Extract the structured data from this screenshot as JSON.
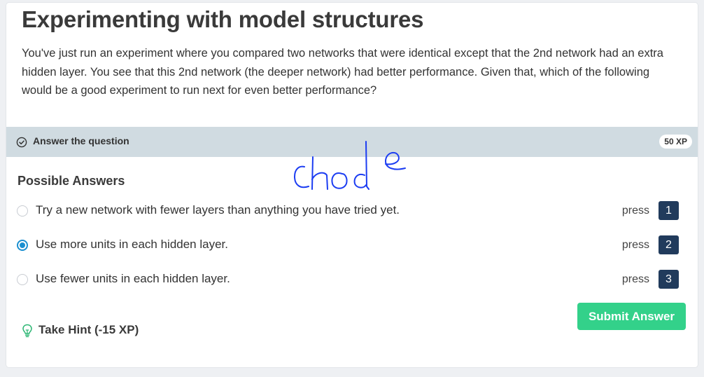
{
  "exercise": {
    "title": "Experimenting with model structures",
    "context": "You've just run an experiment where you compared two networks that were identical except that the 2nd network had an extra hidden layer. You see that this 2nd network (the deeper network) had better performance. Given that, which of the following would be a good experiment to run next for even better performance?"
  },
  "instructions_bar": {
    "icon": "check-circle-icon",
    "label": "Answer the question",
    "xp": "50 XP"
  },
  "annotation": {
    "handwritten_text": "chode",
    "color": "#1c3df2"
  },
  "answers": {
    "heading": "Possible Answers",
    "press_label": "press",
    "options": [
      {
        "label": "Try a new network with fewer layers than anything you have tried yet.",
        "key": "1",
        "selected": false
      },
      {
        "label": "Use more units in each hidden layer.",
        "key": "2",
        "selected": true
      },
      {
        "label": "Use fewer units in each hidden layer.",
        "key": "3",
        "selected": false
      }
    ]
  },
  "actions": {
    "hint_label": "Take Hint (-15 XP)",
    "hint_icon": "lightbulb-icon",
    "submit_label": "Submit Answer"
  },
  "colors": {
    "accent": "#1a8fd0",
    "submit": "#33d18a",
    "key_badge": "#213b5c",
    "bar": "#d0dbe1"
  }
}
